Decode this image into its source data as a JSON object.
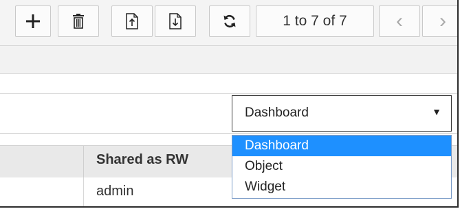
{
  "toolbar": {
    "buttons": [
      {
        "name": "add-button",
        "icon": "plus-icon",
        "glyph": "+"
      },
      {
        "name": "delete-button",
        "icon": "trash-icon"
      },
      {
        "name": "export-button",
        "icon": "upload-file-icon"
      },
      {
        "name": "import-button",
        "icon": "download-file-icon"
      },
      {
        "name": "refresh-button",
        "icon": "refresh-icon"
      }
    ],
    "pager": {
      "label": "1 to 7 of 7",
      "prev_glyph": "‹",
      "next_glyph": "›"
    }
  },
  "filter": {
    "selected": "Dashboard",
    "arrow_glyph": "▼",
    "options": [
      "Dashboard",
      "Object",
      "Widget"
    ],
    "highlighted": "Dashboard"
  },
  "table": {
    "columns": [
      "",
      "Shared as RW"
    ],
    "rows": [
      [
        "",
        "admin"
      ]
    ]
  },
  "colors": {
    "highlight": "#1e90ff",
    "toolbar_bg": "#f4f4f4",
    "header_bg": "#e9e9e9"
  }
}
